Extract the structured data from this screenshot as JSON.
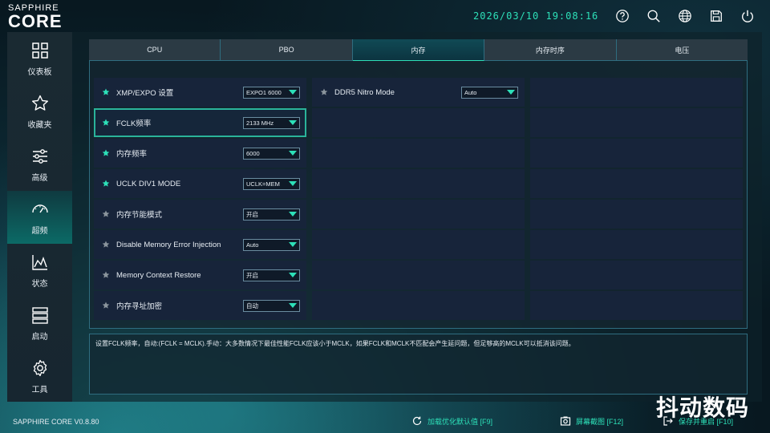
{
  "header": {
    "brand": "SAPPHIRE",
    "product": "CORE",
    "clock": "2026/03/10 19:08:16",
    "icons": [
      "help-icon",
      "search-icon",
      "globe-icon",
      "save-icon",
      "power-icon"
    ]
  },
  "sidebar": {
    "items": [
      {
        "label": "仪表板",
        "icon": "dashboard-icon"
      },
      {
        "label": "收藏夹",
        "icon": "star-icon"
      },
      {
        "label": "高级",
        "icon": "sliders-icon"
      },
      {
        "label": "超频",
        "icon": "speedometer-icon"
      },
      {
        "label": "状态",
        "icon": "chart-icon"
      },
      {
        "label": "启动",
        "icon": "server-icon"
      },
      {
        "label": "工具",
        "icon": "gear-icon"
      }
    ],
    "active_index": 3
  },
  "tabs": [
    "CPU",
    "PBO",
    "内存",
    "内存时序",
    "电压"
  ],
  "active_tab": 2,
  "settings_left": [
    {
      "name": "XMP/EXPO 设置",
      "value": "EXPO1 6000",
      "favorite": true
    },
    {
      "name": "FCLK频率",
      "value": "2133 MHz",
      "favorite": true
    },
    {
      "name": "内存频率",
      "value": "6000",
      "favorite": true
    },
    {
      "name": "UCLK DIV1 MODE",
      "value": "UCLK=MEM",
      "favorite": true
    },
    {
      "name": "内存节能模式",
      "value": "开启",
      "favorite": false
    },
    {
      "name": "Disable Memory Error Injection",
      "value": "Auto",
      "favorite": false
    },
    {
      "name": "Memory Context Restore",
      "value": "开启",
      "favorite": false
    },
    {
      "name": "内存寻址加密",
      "value": "自动",
      "favorite": false
    }
  ],
  "settings_right": [
    {
      "name": "DDR5 Nitro Mode",
      "value": "Auto",
      "favorite": false
    }
  ],
  "description": "设置FCLK频率，自动:(FCLK = MCLK).手动：大多数情况下最佳性能FCLK应该小于MCLK，如果FCLK和MCLK不匹配会产生延问题，但足够高的MCLK可以抵消该问题。",
  "footer": {
    "version": "SAPPHIRE CORE V0.8.80",
    "load_defaults": "加载优化默认值 [F9]",
    "screenshot": "屏幕截图 [F12]",
    "save_restart": "保存并重启 [F10]"
  },
  "watermark": "抖动数码",
  "colors": {
    "accent": "#2de0b8",
    "favorite_star": "#2de0b8",
    "inactive_star": "#8a949c",
    "panel_border": "#2f6d80"
  }
}
